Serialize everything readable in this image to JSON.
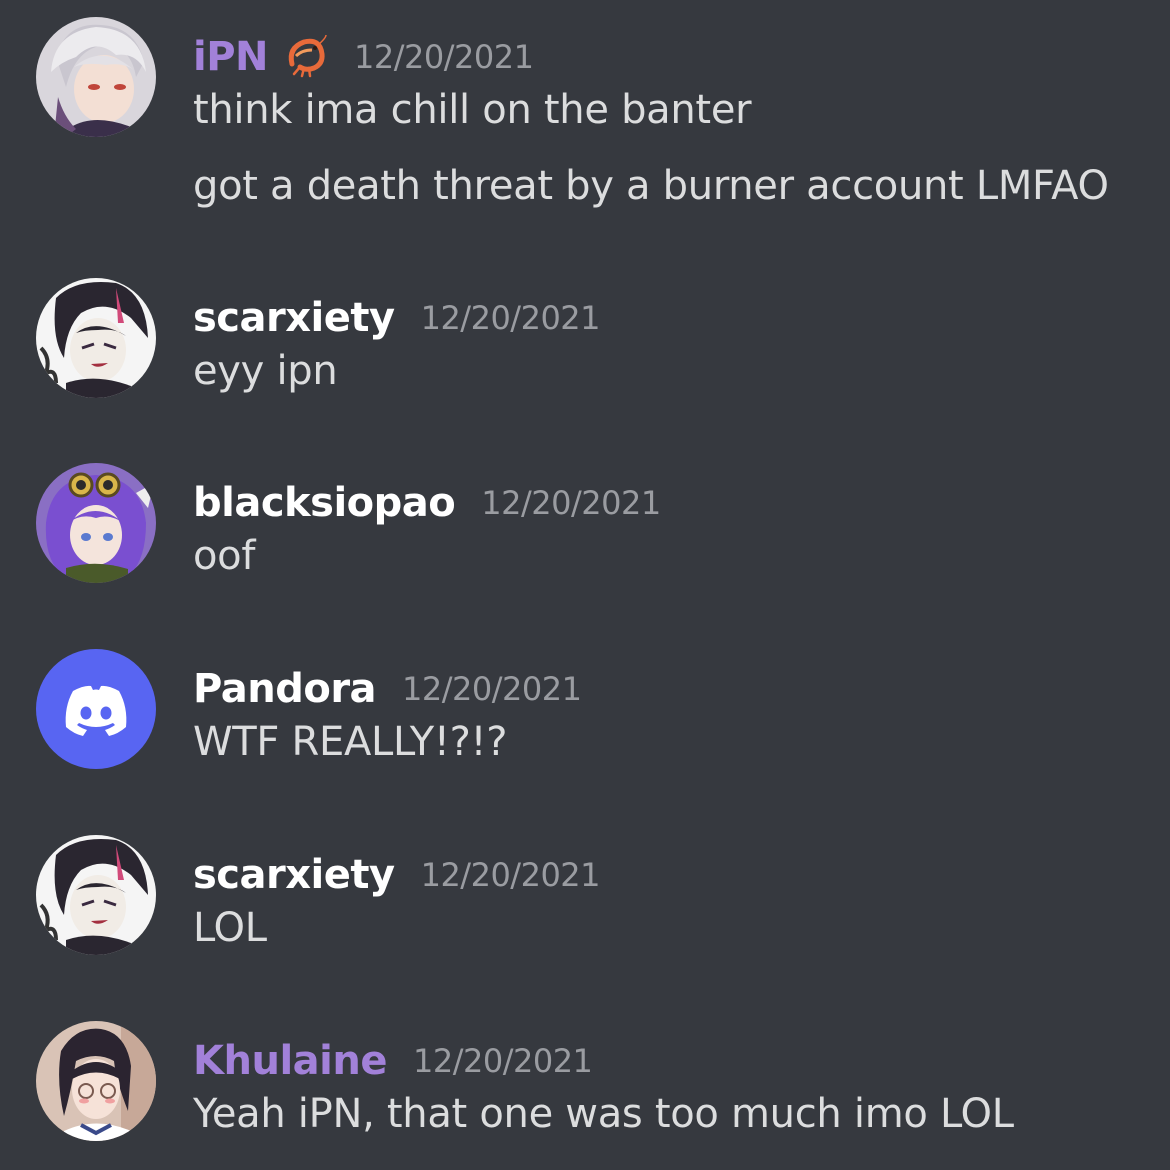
{
  "colors": {
    "background": "#36393f",
    "username_default": "#ffffff",
    "username_role": "#a281d9",
    "timestamp": "#9a9ca1",
    "message_text": "#dcddde",
    "discord_blurple": "#5865f2"
  },
  "messages": [
    {
      "avatar": "anime-silver-hair-avatar",
      "username": "iPN",
      "username_color": "purple",
      "badge_icon": "shrimp-icon",
      "timestamp": "12/20/2021",
      "lines": [
        "think ima chill on the banter",
        "got a death threat by a burner account LMFAO"
      ]
    },
    {
      "avatar": "anime-dark-hair-avatar",
      "username": "scarxiety",
      "timestamp": "12/20/2021",
      "lines": [
        "eyy ipn"
      ]
    },
    {
      "avatar": "anime-purple-hair-goggles-avatar",
      "username": "blacksiopao",
      "timestamp": "12/20/2021",
      "lines": [
        "oof"
      ]
    },
    {
      "avatar": "discord-logo-avatar",
      "username": "Pandora",
      "timestamp": "12/20/2021",
      "lines": [
        "WTF REALLY!?!?"
      ]
    },
    {
      "avatar": "anime-dark-hair-avatar",
      "username": "scarxiety",
      "timestamp": "12/20/2021",
      "lines": [
        "LOL"
      ]
    },
    {
      "avatar": "anime-glasses-girl-avatar",
      "username": "Khulaine",
      "username_color": "purple",
      "timestamp": "12/20/2021",
      "lines": [
        "Yeah iPN, that one was too much imo LOL"
      ]
    }
  ]
}
